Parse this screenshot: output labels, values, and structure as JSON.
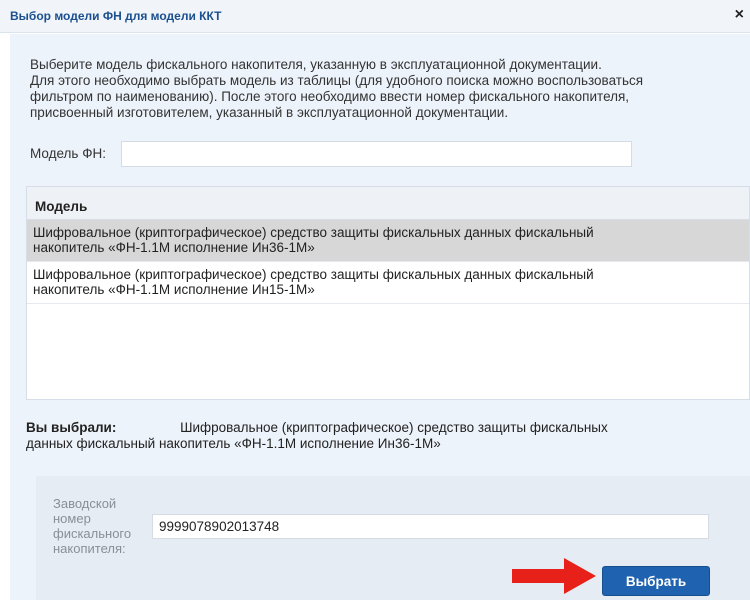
{
  "dialog": {
    "title": "Выбор модели ФН для модели ККТ",
    "close_glyph": "×"
  },
  "intro": {
    "lines": [
      "Выберите модель фискального накопителя, указанную в эксплуатационной документации.",
      "Для этого необходимо выбрать модель из таблицы (для удобного поиска можно воспользоваться",
      "фильтром по наименованию). После этого необходимо ввести номер фискального накопителя,",
      "присвоенный изготовителем, указанный в эксплуатационной документации."
    ]
  },
  "filter": {
    "label": "Модель ФН:",
    "value": ""
  },
  "table": {
    "header": "Модель",
    "rows": [
      {
        "line1": "Шифровальное (криптографическое) средство защиты фискальных данных фискальный",
        "line2": "накопитель «ФН-1.1М исполнение Ин36-1М»",
        "selected": true
      },
      {
        "line1": "Шифровальное (криптографическое) средство защиты фискальных данных фискальный",
        "line2": "накопитель «ФН-1.1М исполнение Ин15-1М»",
        "selected": false
      }
    ]
  },
  "selection": {
    "label": "Вы выбрали:",
    "value_line1": "Шифровальное (криптографическое) средство защиты фискальных",
    "value_line2": "данных фискальный накопитель «ФН-1.1М исполнение Ин36-1М»"
  },
  "serial": {
    "label_lines": [
      "Заводской",
      "номер",
      "фискального",
      "накопителя:"
    ],
    "value": "9999078902013748"
  },
  "actions": {
    "select_label": "Выбрать"
  },
  "colors": {
    "title": "#1b4f8e",
    "accent_button": "#1f63b0",
    "selected_row": "#d7d7d7",
    "arrow": "#e8201a"
  },
  "icons": {
    "close": "close-icon",
    "pointer": "arrow-right-icon"
  }
}
